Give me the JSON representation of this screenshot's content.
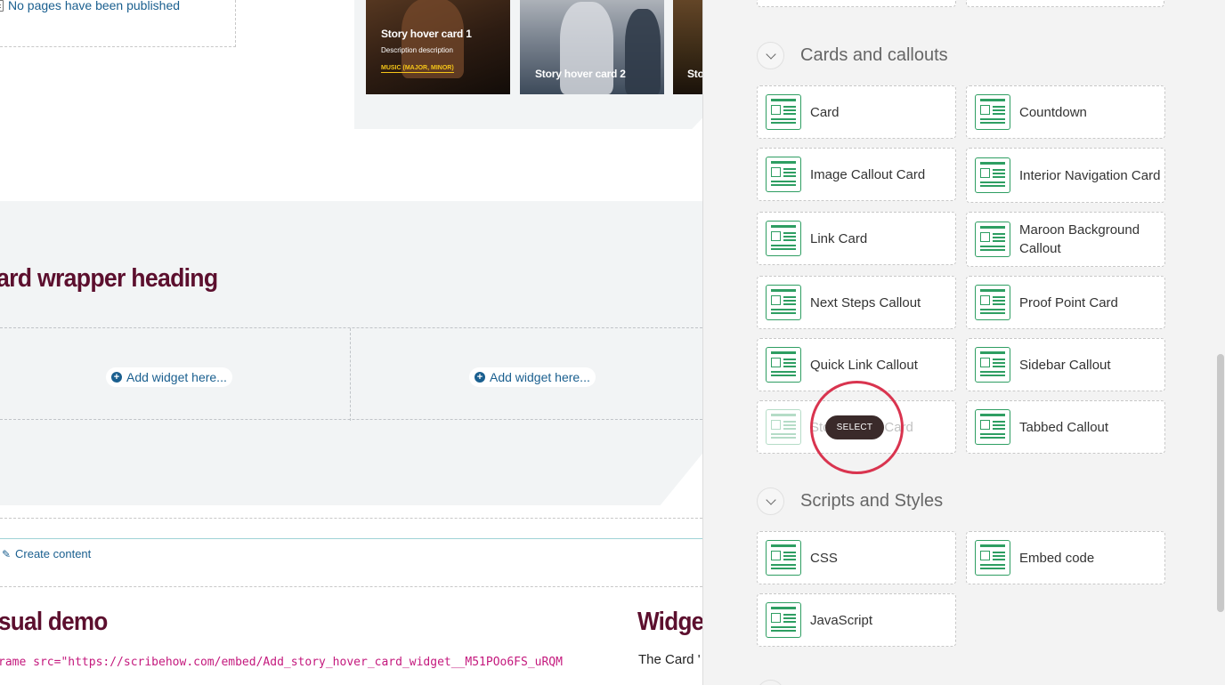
{
  "canvas": {
    "no_pages": "No pages have been published",
    "story_cards": [
      {
        "title": "Story hover card 1",
        "description": "Description description",
        "tag": "MUSIC (MAJOR, MINOR)"
      },
      {
        "title": "Story hover card 2"
      },
      {
        "title": "Sto"
      }
    ],
    "wrapper_heading": "ard wrapper heading",
    "add_widget_label": "Add widget here...",
    "create_content": "Create content",
    "demo_heading": "sual demo",
    "widget_heading": "Widge",
    "iframe_code": "rame src=\"https://scribehow.com/embed/Add_story_hover_card_widget__M51POo6FS_uRQM",
    "card_text": "The Card '"
  },
  "panel": {
    "sections": [
      {
        "title": "Cards and callouts",
        "tiles": [
          {
            "label": "Card"
          },
          {
            "label": "Countdown"
          },
          {
            "label": "Image Callout Card"
          },
          {
            "label": "Interior Navigation Card"
          },
          {
            "label": "Link Card"
          },
          {
            "label": "Maroon Background Callout"
          },
          {
            "label": "Next Steps Callout"
          },
          {
            "label": "Proof Point Card"
          },
          {
            "label": "Quick Link Callout"
          },
          {
            "label": "Sidebar Callout"
          },
          {
            "label": "Story Hover Card"
          },
          {
            "label": "Tabbed Callout"
          }
        ]
      },
      {
        "title": "Scripts and Styles",
        "tiles": [
          {
            "label": "CSS"
          },
          {
            "label": "Embed code"
          },
          {
            "label": "JavaScript"
          }
        ]
      }
    ],
    "select_tooltip": "SELECT"
  },
  "icons": {
    "tile_icon": "layout-block-icon",
    "chevron": "chevron-down-icon",
    "plus": "plus-circle-icon",
    "pencil": "pencil-icon",
    "document": "document-icon"
  },
  "colors": {
    "accent_green": "#2e9e62",
    "maroon": "#5c0f2e",
    "link_blue": "#1a5f8f",
    "highlight_red": "#d9344f"
  }
}
